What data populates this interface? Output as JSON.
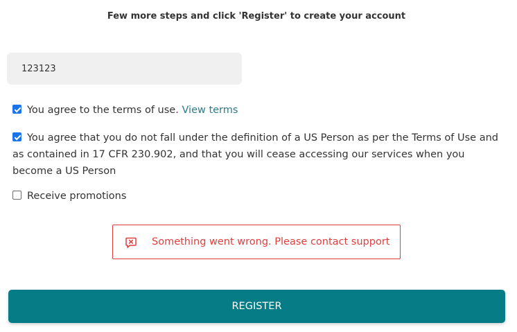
{
  "header": {
    "subtitle": "Few more steps and click 'Register' to create your account"
  },
  "form": {
    "code_input": {
      "value": "123123",
      "placeholder": ""
    },
    "terms": {
      "checked": true,
      "label": "You agree to the terms of use.",
      "link_text": "View terms"
    },
    "us_person": {
      "checked": true,
      "label": "You agree that you do not fall under the definition of a US Person as per the Terms of Use and as contained in 17 CFR 230.902, and that you will cease accessing our services when you become a US Person"
    },
    "promotions": {
      "checked": false,
      "label": "Receive promotions"
    }
  },
  "error": {
    "message": "Something went wrong. Please contact support",
    "icon": "chat-error-icon"
  },
  "actions": {
    "register_label": "REGISTER"
  },
  "colors": {
    "accent": "#067d86",
    "link": "#2b7a8a",
    "error": "#e03e3e",
    "checkbox": "#1a73e8"
  }
}
